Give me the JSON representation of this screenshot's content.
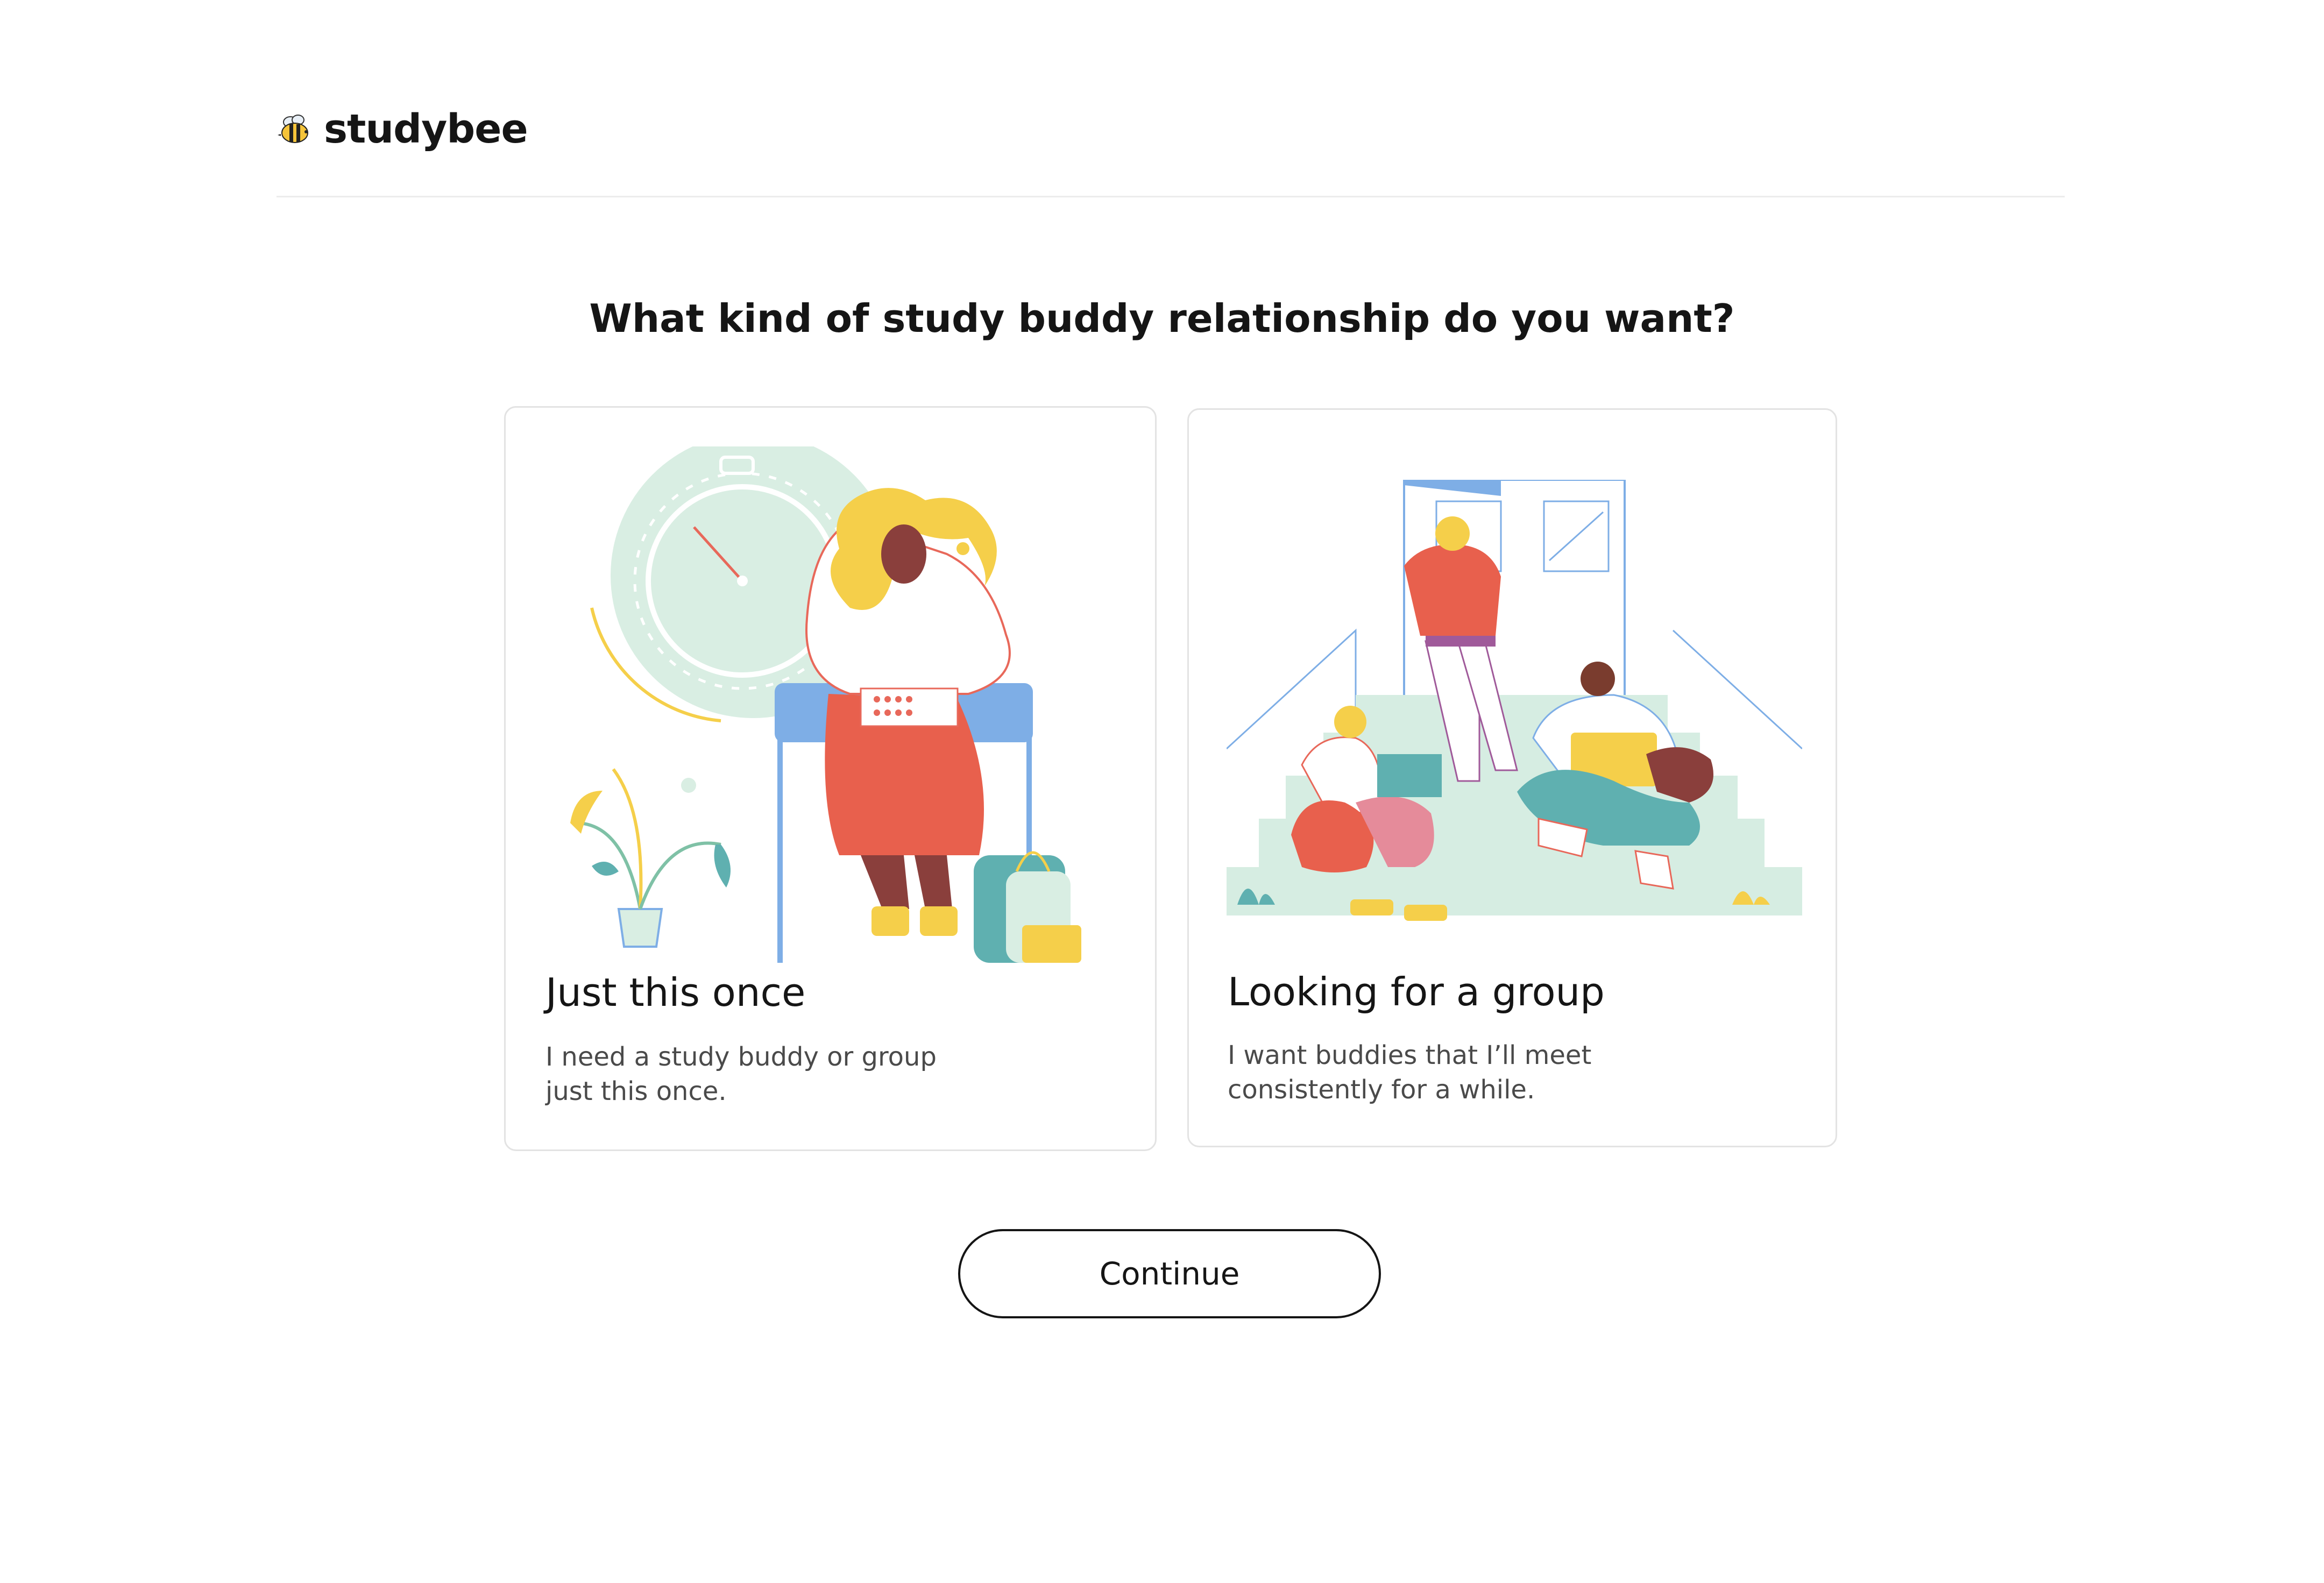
{
  "header": {
    "brand": "studybee",
    "logo_icon": "bee-icon"
  },
  "main": {
    "question": "What kind of study buddy relationship do you want?",
    "options": [
      {
        "title": "Just this once",
        "description": "I need a study buddy or group just this once.",
        "illustration": "student-with-clock-illustration"
      },
      {
        "title": "Looking for a group",
        "description": "I want buddies that I’ll meet consistently for a while.",
        "illustration": "students-on-steps-illustration"
      }
    ],
    "continue_label": "Continue"
  },
  "colors": {
    "accent_yellow": "#f5cf4a",
    "accent_coral": "#e85d48",
    "accent_blue": "#7eaee6",
    "accent_mint": "#d6ede2",
    "accent_teal": "#5fb0b0"
  }
}
